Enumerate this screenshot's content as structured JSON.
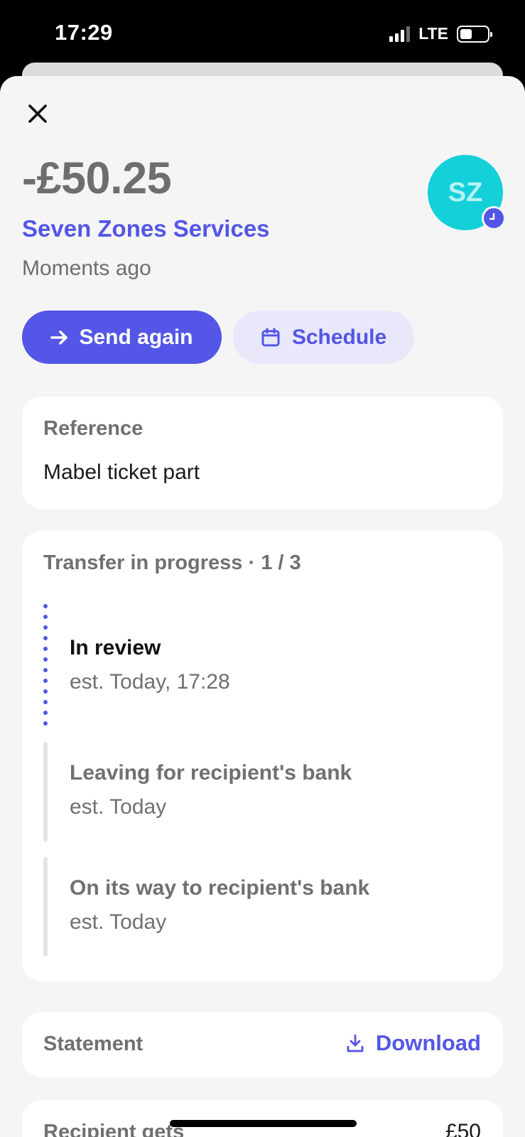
{
  "status_bar": {
    "time": "17:29",
    "network": "LTE",
    "signal_bars_active": 3,
    "signal_bars_total": 4,
    "battery_level": 0.45
  },
  "transaction": {
    "amount": "-£50.25",
    "merchant": "Seven Zones Services",
    "time_ago": "Moments ago",
    "avatar_initials": "SZ",
    "avatar_color": "#14d0d9",
    "avatar_badge_icon": "clock-icon"
  },
  "actions": {
    "send_again_label": "Send again",
    "send_again_icon": "arrow-right-icon",
    "schedule_label": "Schedule",
    "schedule_icon": "calendar-icon"
  },
  "reference": {
    "label": "Reference",
    "value": "Mabel ticket part"
  },
  "progress": {
    "title": "Transfer in progress · 1 / 3",
    "current_step": 1,
    "total_steps": 3,
    "steps": [
      {
        "title": "In review",
        "subtitle": "est. Today, 17:28",
        "active": true
      },
      {
        "title": "Leaving for recipient's bank",
        "subtitle": "est. Today",
        "active": false
      },
      {
        "title": "On its way to recipient's bank",
        "subtitle": "est. Today",
        "active": false
      }
    ]
  },
  "statement": {
    "label": "Statement",
    "download_label": "Download",
    "download_icon": "download-icon"
  },
  "recipient": {
    "label": "Recipient gets",
    "value": "£50"
  },
  "colors": {
    "accent": "#5356e6",
    "accent_light": "#e8e8fa",
    "background": "#f5f5f5",
    "muted_text": "#707070"
  }
}
